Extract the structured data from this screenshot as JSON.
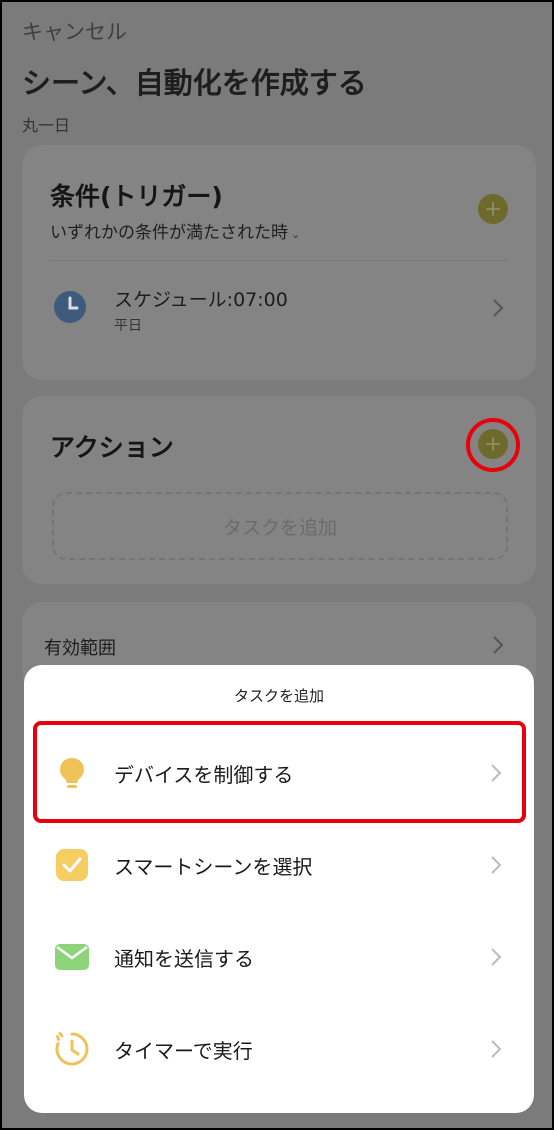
{
  "header": {
    "cancel_label": "キャンセル",
    "title": "シーン、自動化を作成する",
    "subtitle": "丸一日"
  },
  "condition_card": {
    "title": "条件(トリガー)",
    "mode": "いずれかの条件が満たされた時",
    "mode_caret": "⌄",
    "schedule": {
      "title": "スケジュール:07:00",
      "subtitle": "平日"
    }
  },
  "action_card": {
    "title": "アクション",
    "add_task_label": "タスクを追加"
  },
  "scope_card": {
    "label": "有効範囲"
  },
  "sheet": {
    "title": "タスクを追加",
    "items": [
      {
        "label": "デバイスを制御する",
        "icon": "lightbulb-icon"
      },
      {
        "label": "スマートシーンを選択",
        "icon": "checkbox-icon"
      },
      {
        "label": "通知を送信する",
        "icon": "envelope-icon"
      },
      {
        "label": "タイマーで実行",
        "icon": "timer-icon"
      }
    ]
  },
  "colors": {
    "overlay": "#7b7b7b",
    "highlight": "#e8000b",
    "bulb": "#f0c35a",
    "check": "#f5cd62",
    "mail": "#8dd37a"
  }
}
